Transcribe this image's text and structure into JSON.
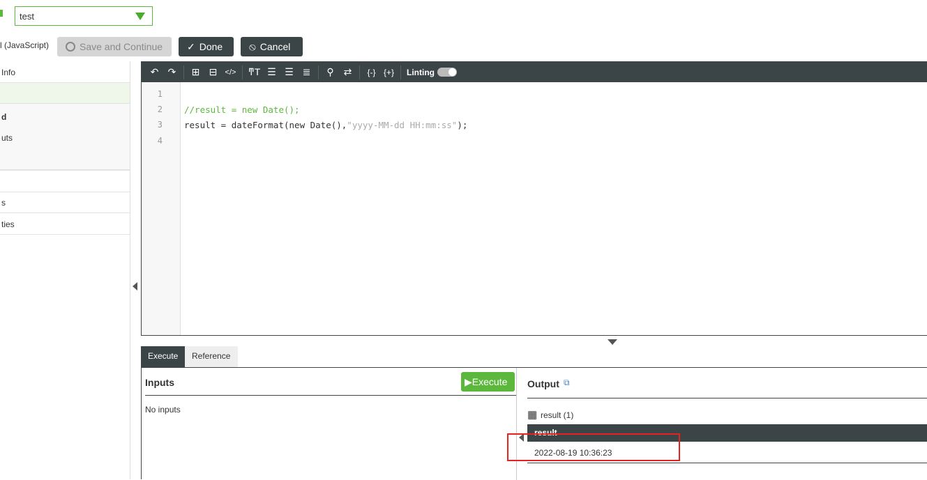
{
  "header": {
    "select_value": "test",
    "language_label": "l (JavaScript)",
    "save_continue": "Save and Continue",
    "done": "Done",
    "cancel": "Cancel"
  },
  "sidebar": {
    "items": [
      "Info",
      "",
      "d",
      "uts",
      "",
      "s",
      "ties"
    ]
  },
  "toolbar": {
    "linting": "Linting"
  },
  "editor": {
    "line_numbers": [
      "1",
      "2",
      "3",
      "4"
    ],
    "line2": "//result = new Date();",
    "line3_a": "result = dateFormat(new Date(),",
    "line3_str": "\"yyyy-MM-dd HH:mm:ss\"",
    "line3_b": ");"
  },
  "tabs": {
    "execute": "Execute",
    "reference": "Reference"
  },
  "inputs": {
    "title": "Inputs",
    "execute_button": "Execute",
    "empty": "No inputs"
  },
  "output": {
    "title": "Output",
    "table_label": "result (1)",
    "column": "result",
    "value": "2022-08-19 10:36:23"
  },
  "colors": {
    "accent": "#5cb83c",
    "dark": "#3b4446",
    "highlight": "#e8231f"
  }
}
